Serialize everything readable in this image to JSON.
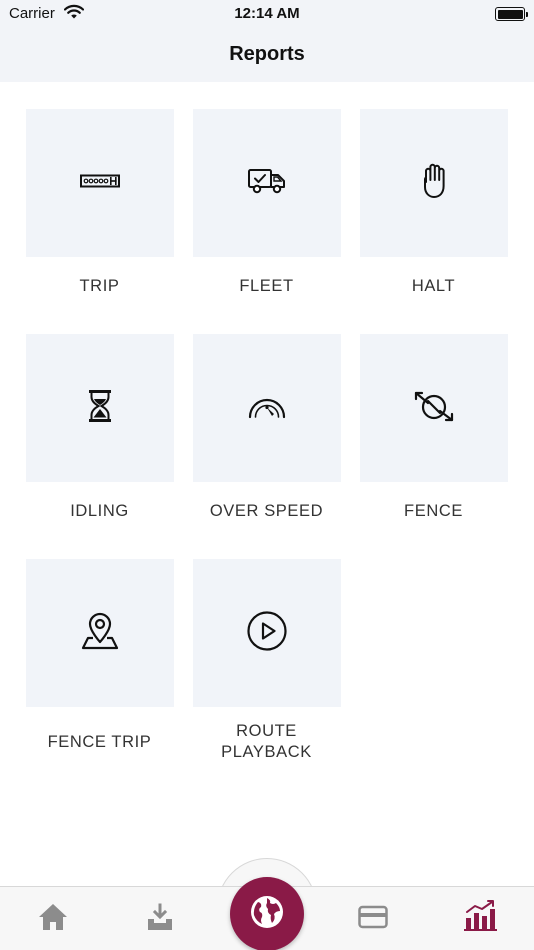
{
  "status_bar": {
    "carrier": "Carrier",
    "time": "12:14 AM"
  },
  "header": {
    "title": "Reports"
  },
  "reports": [
    {
      "label": "TRIP",
      "icon": "odometer-icon"
    },
    {
      "label": "FLEET",
      "icon": "delivery-truck-icon"
    },
    {
      "label": "HALT",
      "icon": "hand-stop-icon"
    },
    {
      "label": "IDLING",
      "icon": "hourglass-icon"
    },
    {
      "label": "OVER SPEED",
      "icon": "speedometer-icon"
    },
    {
      "label": "FENCE",
      "icon": "fence-crossing-icon"
    },
    {
      "label": "FENCE TRIP",
      "icon": "map-pin-icon"
    },
    {
      "label_line1": "ROUTE",
      "label_line2": "PLAYBACK",
      "icon": "play-circle-icon"
    }
  ],
  "tab_bar": {
    "items": [
      "home-icon",
      "download-tray-icon",
      "globe-icon",
      "credit-card-icon",
      "bar-chart-trend-icon"
    ],
    "active": "bar-chart-trend-icon",
    "accent_color": "#8a1a47",
    "inactive_color": "#8c8c8c"
  },
  "colors": {
    "header_bg": "#f2f4f8",
    "tile_bg": "#f1f4f9"
  }
}
